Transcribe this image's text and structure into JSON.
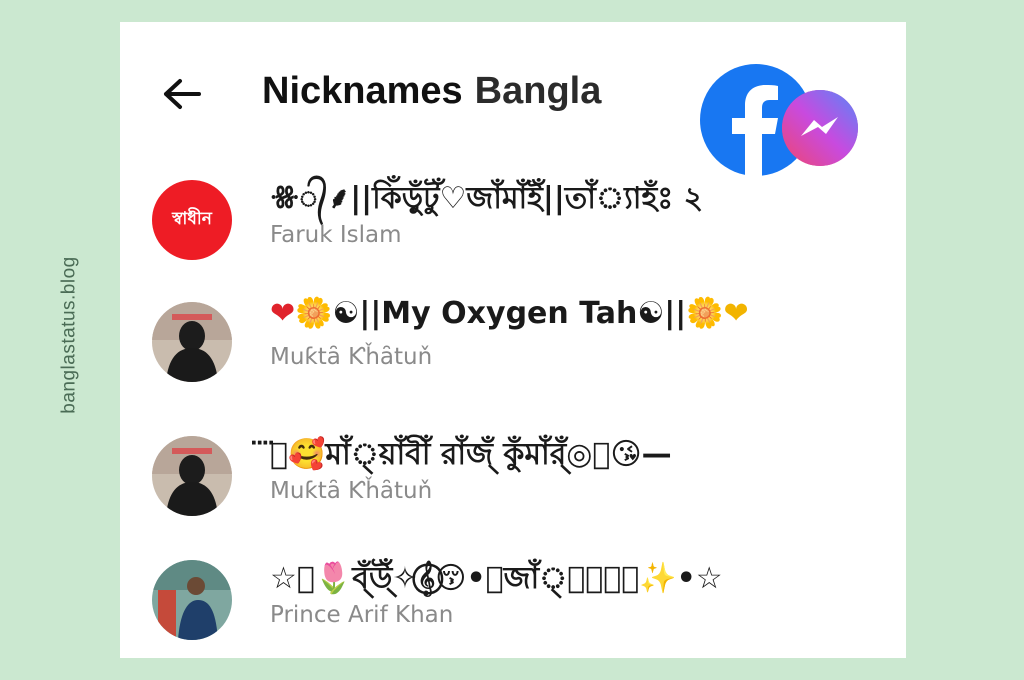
{
  "watermark": "banglastatus.blog",
  "header": {
    "title_part1": "Nicknames",
    "title_part2": "Bangla"
  },
  "icons": {
    "back": "arrow-left-icon",
    "facebook": "facebook-logo",
    "messenger": "messenger-logo"
  },
  "colors": {
    "background": "#cbe8d0",
    "facebook_blue": "#1877f2",
    "messenger_pink": "#e0407d",
    "avatar_red": "#ee1c25"
  },
  "contacts": [
    {
      "avatar_text": "স্বাধীন",
      "nickname": "ꗥ᭄⸙||কিঁড়ুঁটুঁ♡জাঁমাঁইঁ||তাঁ্যাহঁঃ ২",
      "name": "Faruk Islam"
    },
    {
      "avatar_text": "",
      "nickname_prefix": "❤🌼",
      "nickname": "☯||My Oxygen Tah☯||",
      "nickname_suffix": "🌼❤",
      "name": "Muƙtȃ Ƙȟȃtuň"
    },
    {
      "avatar_text": "",
      "nickname": "⃜⃜⃜⃜⃝🥰মাঁ্য়াঁবীঁ রাঁজ্ঁ কুঁমাঁর্ঁ◎⃝😘—",
      "name": "Muƙtȃ Ƙȟȃtuň"
    },
    {
      "avatar_text": "",
      "nickname": "☆⃝🌷ব্ঁউ্ঁ✧𝄞⃝😚•𝄞জাঁ্ন্স⃝✨•☆",
      "name": "Prince Arif Khan"
    }
  ]
}
